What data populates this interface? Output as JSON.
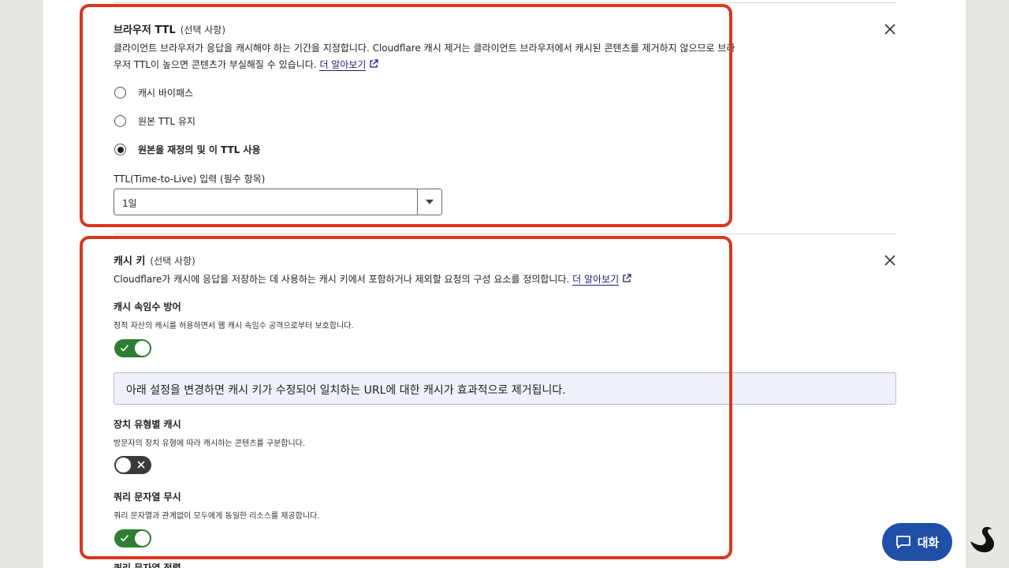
{
  "browser_ttl": {
    "title": "브라우저 TTL",
    "optional": "(선택 사항)",
    "desc_line1": "클라이언트 브라우저가 응답을 캐시해야 하는 기간을 지정합니다. Cloudflare 캐시 제거는 클라이언트 브라우저에서 캐시된 콘텐츠를 제거하지 않으므로 브라",
    "desc_line2": "우저 TTL이 높으면 콘텐츠가 부실해질 수 있습니다.",
    "learn_more": "더 알아보기",
    "options": [
      {
        "label": "캐시 바이패스",
        "checked": false
      },
      {
        "label": "원본 TTL 유지",
        "checked": false
      },
      {
        "label": "원본을 재정의 및 이 TTL 사용",
        "checked": true
      }
    ],
    "ttl_label": "TTL(Time-to-Live) 입력 (필수 항목)",
    "ttl_value": "1일"
  },
  "cache_key": {
    "title": "캐시 키",
    "optional": "(선택 사항)",
    "desc": "Cloudflare가 캐시에 응답을 저장하는 데 사용하는 캐시 키에서 포함하거나 제외할 요청의 구성 요소를 정의합니다.",
    "learn_more": "더 알아보기",
    "deception": {
      "title": "캐시 속임수 방어",
      "desc": "정적 자산의 캐시를 허용하면서 웹 캐시 속임수 공격으로부터 보호합니다.",
      "enabled": true
    },
    "notice": "아래 설정을 변경하면 캐시 키가 수정되어 일치하는 URL에 대한 캐시가 효과적으로 제거됩니다.",
    "device_type": {
      "title": "장치 유형별 캐시",
      "desc": "방문자의 장치 유형에 따라 캐시하는 콘텐츠를 구분합니다.",
      "enabled": false
    },
    "ignore_query": {
      "title": "쿼리 문자열 무시",
      "desc": "쿼리 문자열과 관계없이 모두에게 동일한 리소스를 제공합니다.",
      "enabled": true
    },
    "next_title_cut": "쿼리 문자열 정렬"
  },
  "chat_button": "대화",
  "colors": {
    "highlight": "#d9371f",
    "toggle_on": "#2e7d32",
    "toggle_off": "#3a3a3a",
    "chat": "#1e50a8",
    "link": "#1a1f71"
  },
  "icons": [
    "close-icon",
    "external-link-icon",
    "dropdown-arrow-icon",
    "check-icon",
    "x-icon",
    "chat-bubble-icon",
    "swan-logo"
  ]
}
